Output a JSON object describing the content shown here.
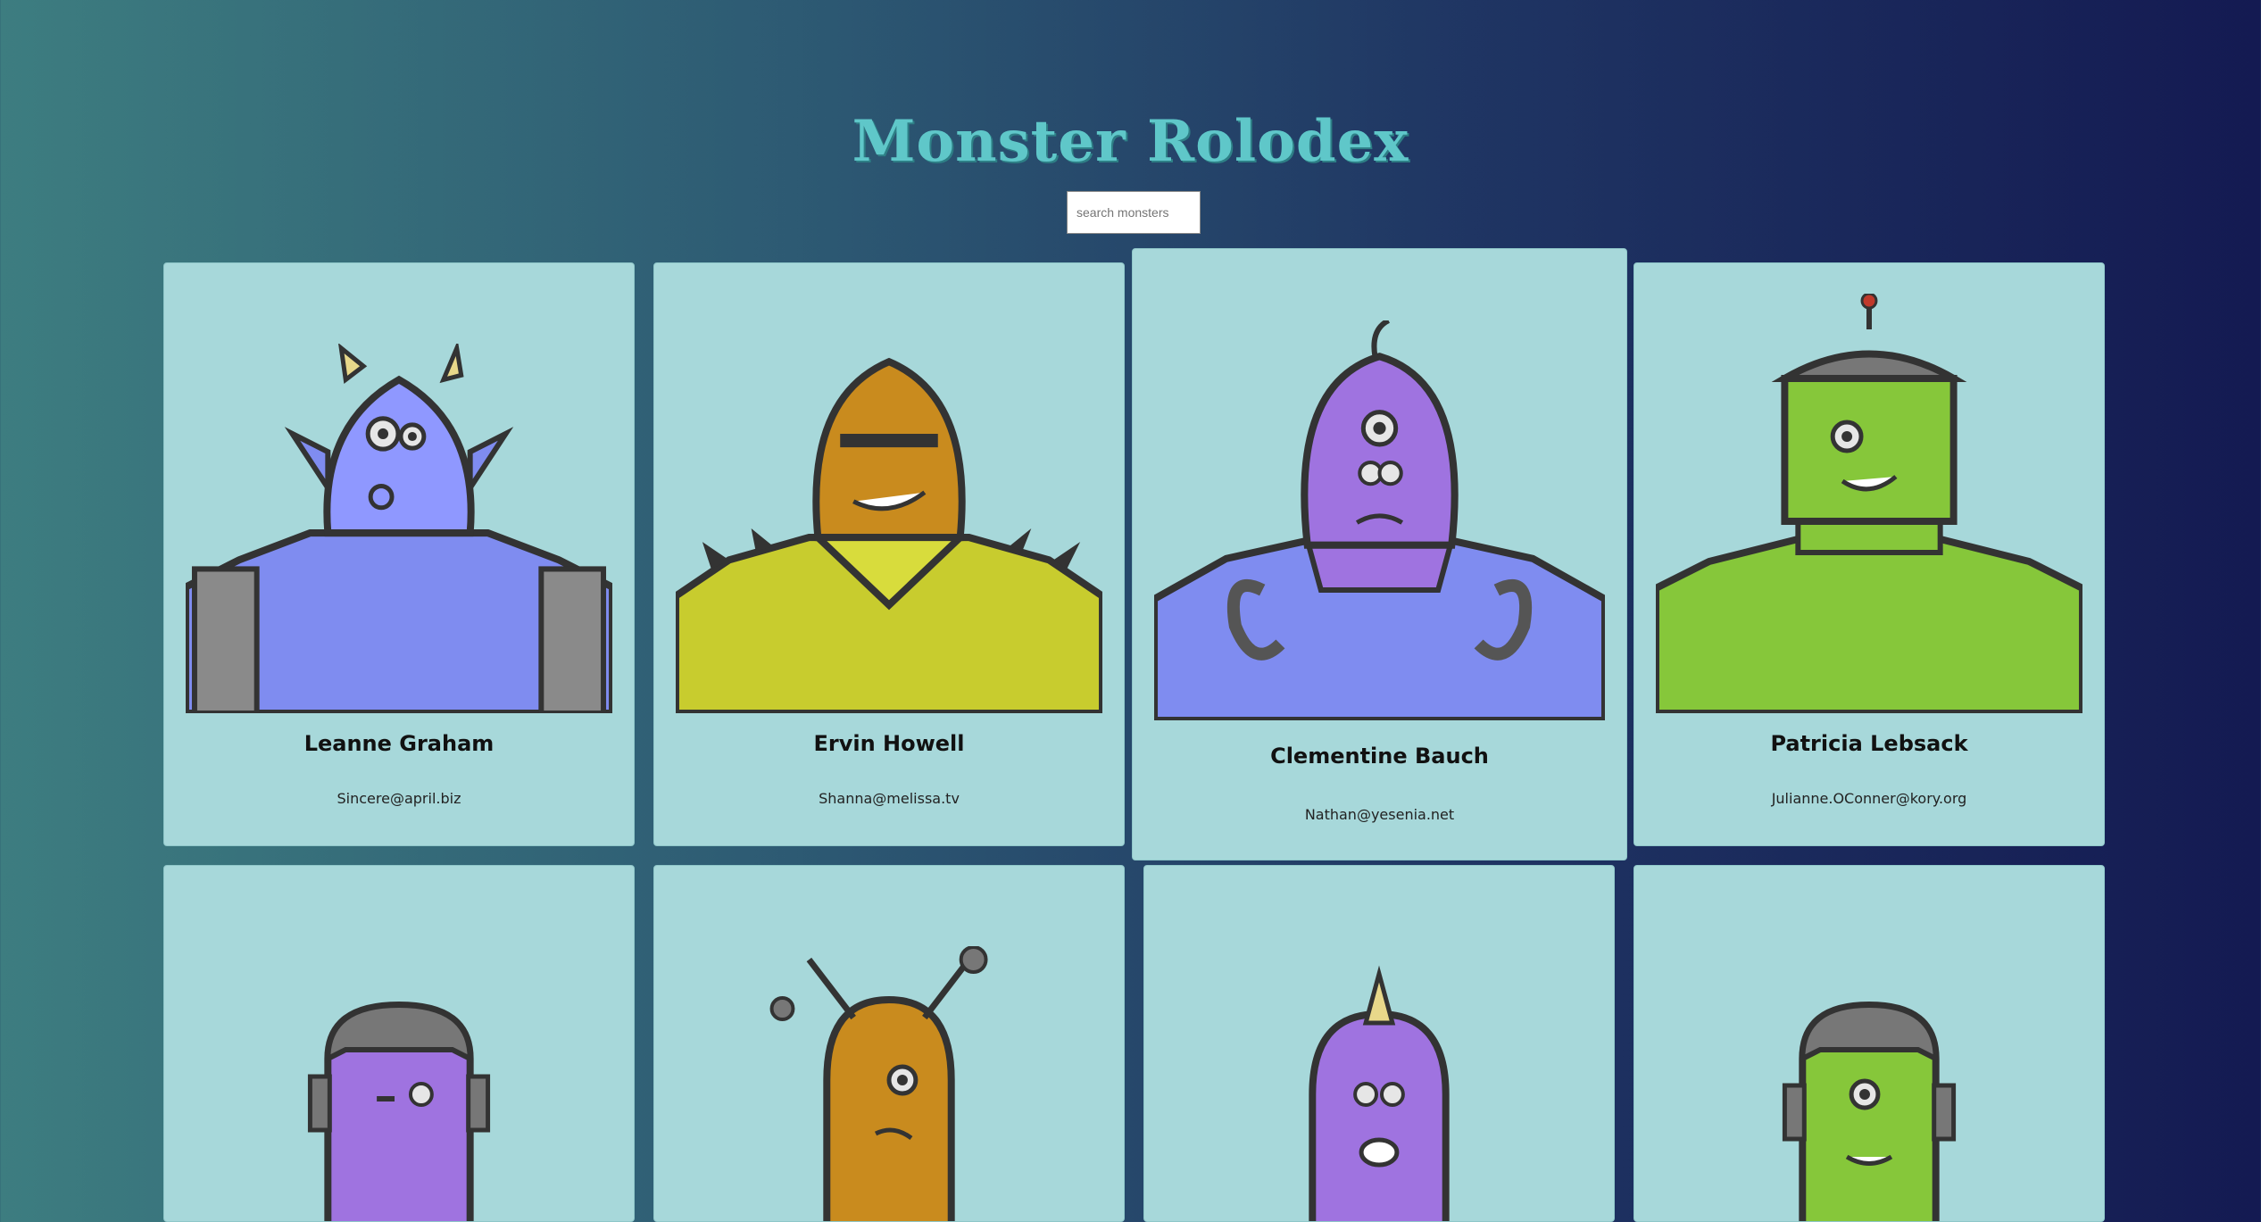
{
  "header": {
    "title": "Monster Rolodex"
  },
  "search": {
    "placeholder": "search monsters"
  },
  "colors": {
    "card_background": "#a7d8da",
    "title_color": "#5fc7c9",
    "monster_blue": "#7f8cf0",
    "monster_gold": "#c98b1e",
    "monster_purple": "#9f73e0",
    "monster_green": "#86c73a",
    "suit_yellow": "#c8cc2e"
  },
  "monsters": [
    {
      "name": "Leanne Graham",
      "email": "Sincere@april.biz"
    },
    {
      "name": "Ervin Howell",
      "email": "Shanna@melissa.tv"
    },
    {
      "name": "Clementine Bauch",
      "email": "Nathan@yesenia.net"
    },
    {
      "name": "Patricia Lebsack",
      "email": "Julianne.OConner@kory.org"
    },
    {
      "name": "",
      "email": ""
    },
    {
      "name": "",
      "email": ""
    },
    {
      "name": "",
      "email": ""
    },
    {
      "name": "",
      "email": ""
    }
  ]
}
